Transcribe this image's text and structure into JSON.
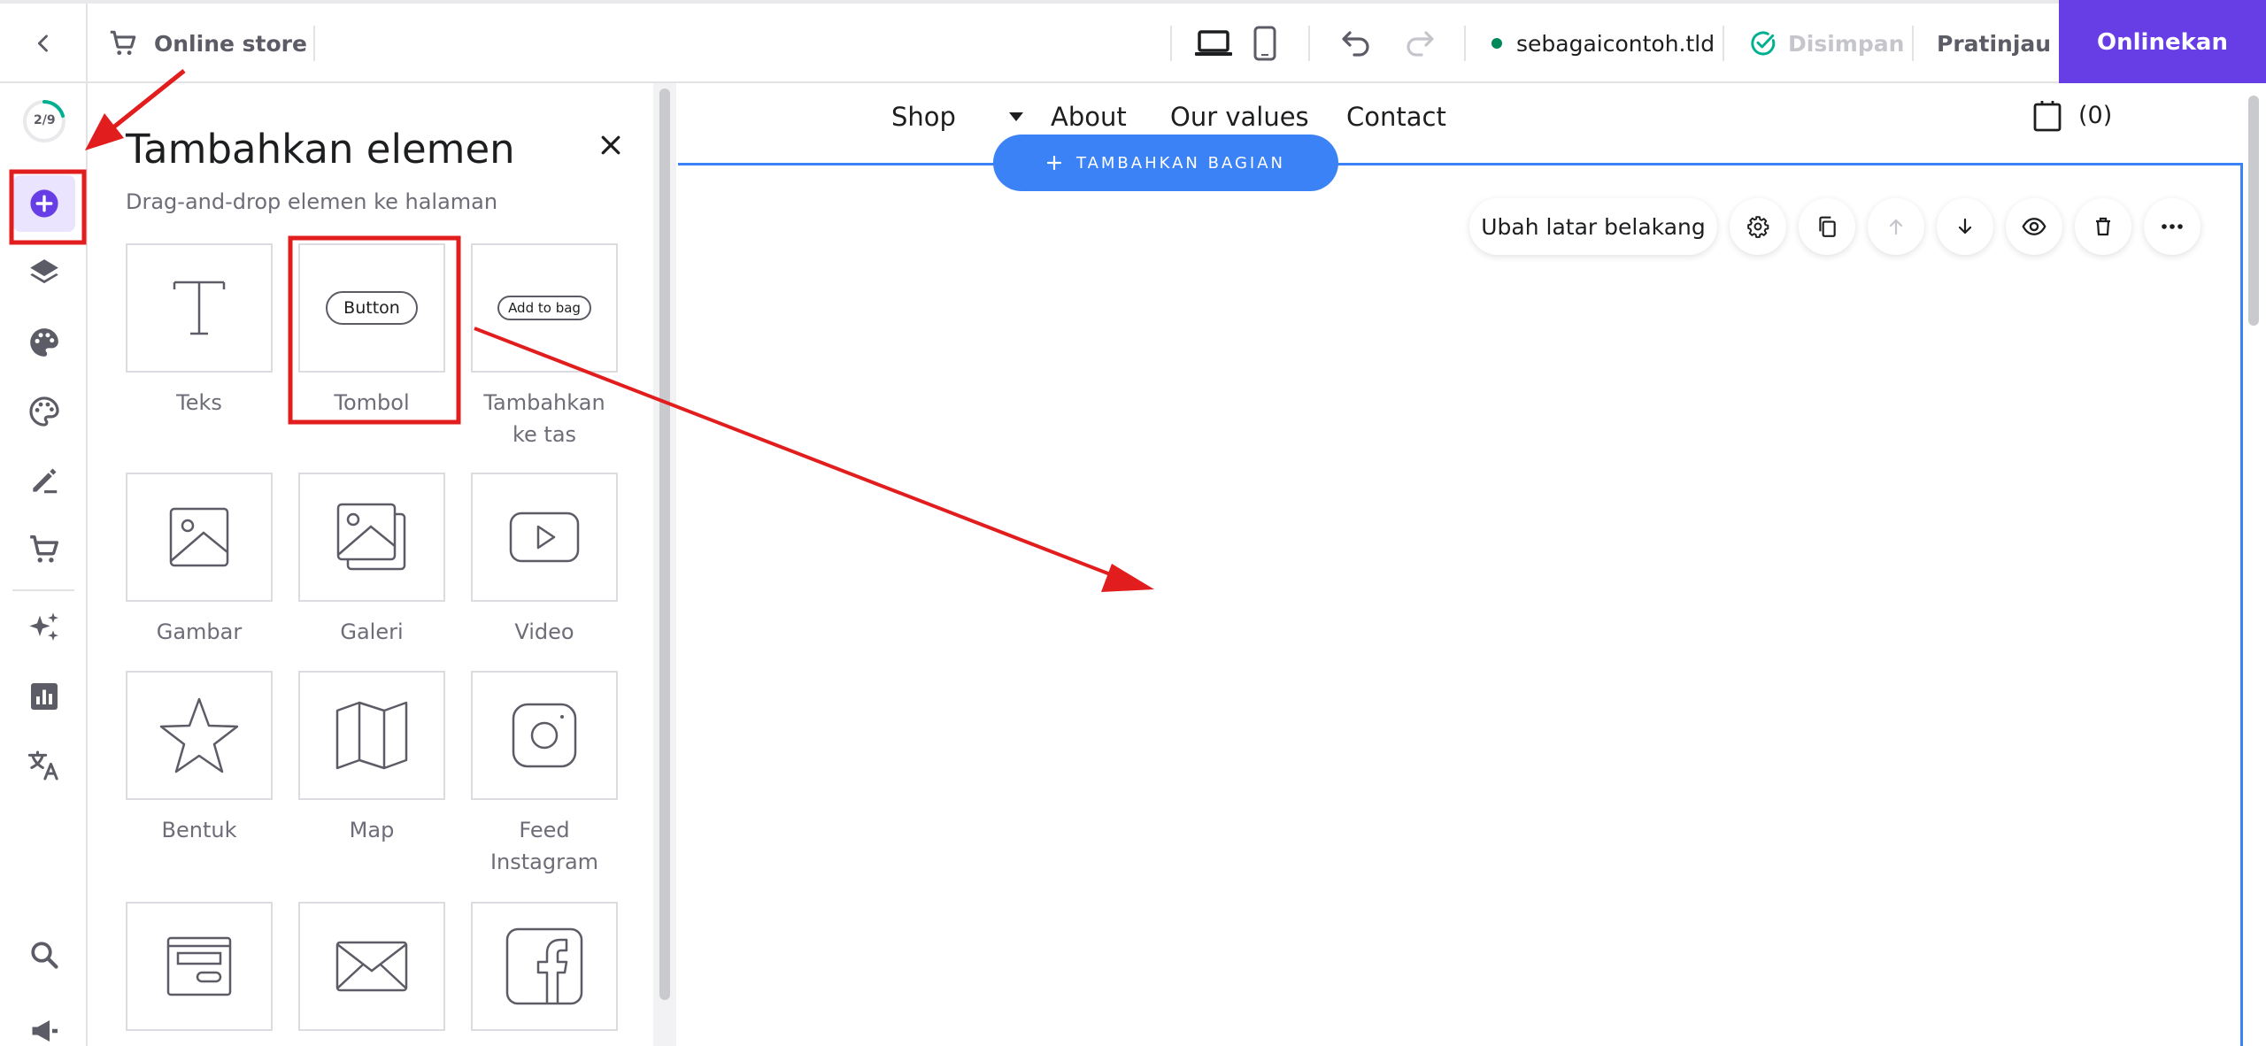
{
  "topbar": {
    "store_label": "Online store",
    "domain": "sebagaicontoh.tld",
    "saved_label": "Disimpan",
    "preview_label": "Pratinjau",
    "publish_label": "Onlinekan",
    "colors": {
      "accent": "#673de6",
      "status_dot": "#00875a",
      "saved_check": "#00b090"
    }
  },
  "rail": {
    "progress": {
      "label": "2/9",
      "done": 2,
      "total": 9
    },
    "items": [
      {
        "name": "add-element",
        "icon": "plus-circle-icon",
        "active": true
      },
      {
        "name": "layers",
        "icon": "layers-icon"
      },
      {
        "name": "styles",
        "icon": "palette-icon"
      },
      {
        "name": "theme",
        "icon": "palette-outline-icon"
      },
      {
        "name": "edit",
        "icon": "edit-pen-icon"
      },
      {
        "name": "store",
        "icon": "cart-icon"
      },
      {
        "name": "ai-tools",
        "icon": "sparkles-icon"
      },
      {
        "name": "analytics",
        "icon": "chart-icon"
      },
      {
        "name": "translate",
        "icon": "translate-icon"
      },
      {
        "name": "search",
        "icon": "search-icon"
      },
      {
        "name": "marketing",
        "icon": "megaphone-icon"
      }
    ]
  },
  "panel": {
    "title": "Tambahkan elemen",
    "subtitle": "Drag-and-drop elemen ke halaman",
    "tiles": [
      {
        "label": "Teks",
        "icon": "text-icon"
      },
      {
        "label": "Tombol",
        "icon": "button-icon",
        "preview_text": "Button"
      },
      {
        "label": "Tambahkan ke tas",
        "icon": "add-to-bag-icon",
        "preview_text": "Add to bag"
      },
      {
        "label": "Gambar",
        "icon": "image-icon"
      },
      {
        "label": "Galeri",
        "icon": "gallery-icon"
      },
      {
        "label": "Video",
        "icon": "video-icon"
      },
      {
        "label": "Bentuk",
        "icon": "star-icon"
      },
      {
        "label": "Map",
        "icon": "map-icon"
      },
      {
        "label": "Feed Instagram",
        "icon": "instagram-icon"
      },
      {
        "label": "",
        "icon": "form-icon"
      },
      {
        "label": "",
        "icon": "mail-icon"
      },
      {
        "label": "",
        "icon": "facebook-icon"
      }
    ]
  },
  "canvas": {
    "nav": [
      "Shop",
      "About",
      "Our values",
      "Contact"
    ],
    "cart_count": "(0)",
    "add_section_label": "TAMBAHKAN BAGIAN",
    "change_bg_label": "Ubah latar belakang",
    "colors": {
      "section_border": "#3b82f6",
      "add_button": "#3b82f6"
    }
  },
  "annotations": {
    "arrow_color": "#e11d1d"
  }
}
